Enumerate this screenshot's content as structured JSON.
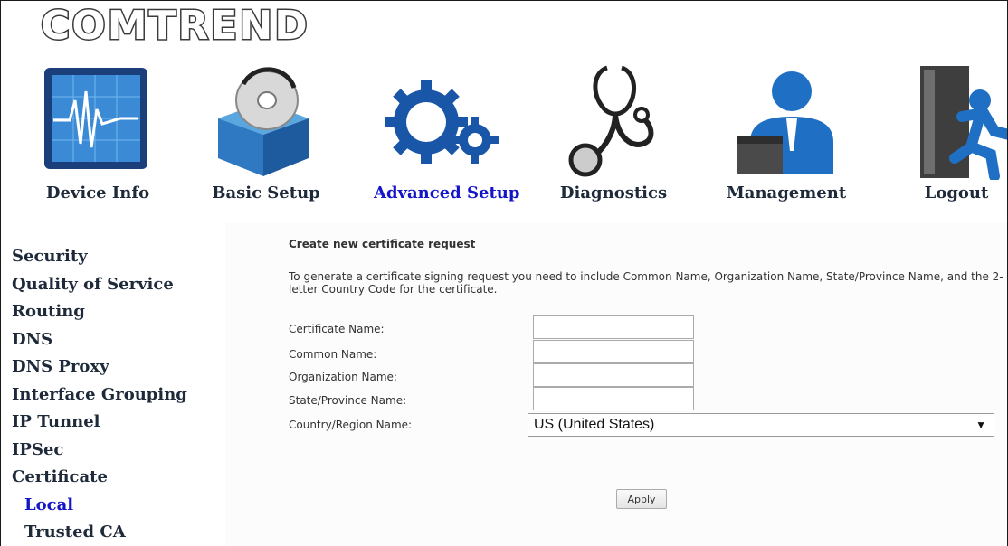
{
  "brand": {
    "logo_text": "COMTREND"
  },
  "nav": {
    "items": [
      {
        "label": "Device Info",
        "icon": "device-info-icon"
      },
      {
        "label": "Basic Setup",
        "icon": "basic-setup-icon"
      },
      {
        "label": "Advanced Setup",
        "icon": "advanced-setup-icon",
        "active": true
      },
      {
        "label": "Diagnostics",
        "icon": "stethoscope-icon"
      },
      {
        "label": "Management",
        "icon": "management-icon"
      },
      {
        "label": "Logout",
        "icon": "logout-icon"
      }
    ],
    "active_color": "#1414c8"
  },
  "sidebar": {
    "items": [
      {
        "label": "Security"
      },
      {
        "label": "Quality of Service"
      },
      {
        "label": "Routing"
      },
      {
        "label": "DNS"
      },
      {
        "label": "DNS Proxy"
      },
      {
        "label": "Interface Grouping"
      },
      {
        "label": "IP Tunnel"
      },
      {
        "label": "IPSec"
      },
      {
        "label": "Certificate"
      },
      {
        "label": "Local",
        "sub": true,
        "active": true
      },
      {
        "label": "Trusted CA",
        "sub": true
      }
    ]
  },
  "form": {
    "heading": "Create new certificate request",
    "description": "To generate a certificate signing request you need to include Common Name, Organization Name, State/Province Name, and the 2-letter Country Code for the certificate.",
    "fields": {
      "certificate_name": {
        "label": "Certificate Name:",
        "value": ""
      },
      "common_name": {
        "label": "Common Name:",
        "value": ""
      },
      "organization_name": {
        "label": "Organization Name:",
        "value": ""
      },
      "state_name": {
        "label": "State/Province Name:",
        "value": ""
      },
      "country": {
        "label": "Country/Region Name:",
        "selected": "US (United States)"
      }
    },
    "apply_label": "Apply"
  }
}
